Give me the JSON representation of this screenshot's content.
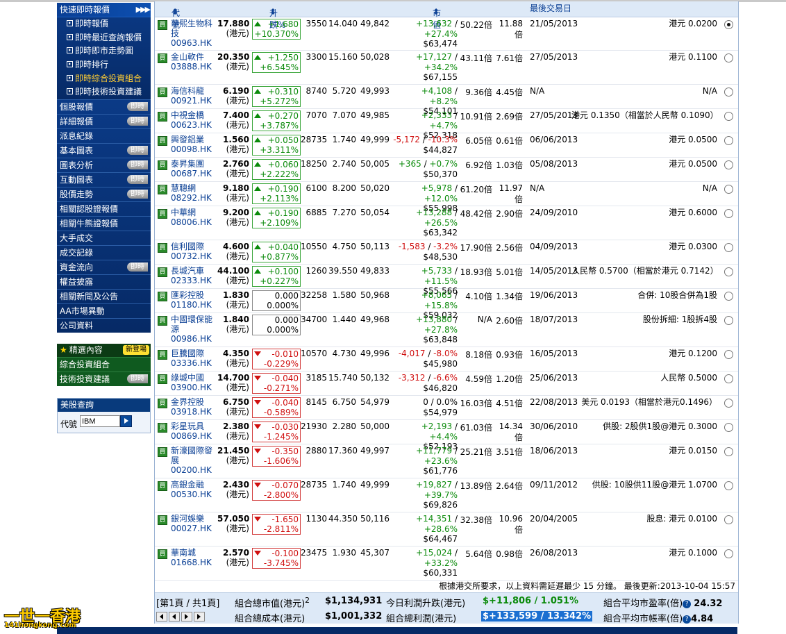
{
  "sidebar": {
    "quick_menu_title": "快速即時報價",
    "quick_items": [
      "即時報價",
      "即時最近查詢報價",
      "即時即市走勢圖",
      "即時排行",
      "即時綜合投資組合",
      "即時技術投資建議"
    ],
    "active_quick_index": 4,
    "nav_items": [
      {
        "label": "個股報價",
        "badge": "即時"
      },
      {
        "label": "詳細報價",
        "badge": "即時"
      },
      {
        "label": "派息紀錄",
        "badge": ""
      },
      {
        "label": "基本圖表",
        "badge": "即時"
      },
      {
        "label": "圖表分析",
        "badge": "即時"
      },
      {
        "label": "互動圖表",
        "badge": "即時"
      },
      {
        "label": "股價走勢",
        "badge": "即時"
      },
      {
        "label": "相關認股證報價",
        "badge": ""
      },
      {
        "label": "相關牛熊證報價",
        "badge": ""
      },
      {
        "label": "大手成交",
        "badge": ""
      },
      {
        "label": "成交記錄",
        "badge": ""
      },
      {
        "label": "資金流向",
        "badge": "即時"
      },
      {
        "label": "權益披露",
        "badge": ""
      },
      {
        "label": "相關新聞及公告",
        "badge": ""
      },
      {
        "label": "AA市場異動",
        "badge": ""
      },
      {
        "label": "公司資料",
        "badge": ""
      }
    ],
    "featured": {
      "title": "精選內容",
      "new_badge": "新登場",
      "items": [
        {
          "label": "綜合投資組合",
          "badge": ""
        },
        {
          "label": "技術投資建議",
          "badge": "即時"
        }
      ]
    },
    "us_quote": {
      "title": "美股查詢",
      "code_label": "代號",
      "code_value": "IBM"
    }
  },
  "table": {
    "headers": {
      "code": "代號",
      "change": "升跌%",
      "market_value": "市值",
      "last_trade_date": "最後交易日"
    },
    "buy_label": "買",
    "unit": "(港元)",
    "rows": [
      {
        "name": "華熙生物科技",
        "code": "00963.HK",
        "price": "17.880",
        "chg": "+1.680",
        "pct": "+10.370%",
        "dir": "up",
        "qty": "3550",
        "cost": "14.040",
        "avg": "49,842",
        "pl": "+13,632",
        "plpct": "+27.4%",
        "mv": "$63,474",
        "pldir": "up",
        "pe": "50.22倍",
        "pb": "11.88倍",
        "date": "21/05/2013",
        "div": "港元  0.0200",
        "selected": true,
        "h": 48
      },
      {
        "name": "金山軟件",
        "code": "03888.HK",
        "price": "20.350",
        "chg": "+1.250",
        "pct": "+6.545%",
        "dir": "up",
        "qty": "3300",
        "cost": "15.160",
        "avg": "50,028",
        "pl": "+17,127",
        "plpct": "+34.2%",
        "mv": "$67,155",
        "pldir": "up",
        "pe": "43.11倍",
        "pb": "7.61倍",
        "date": "27/05/2013",
        "div": "港元  0.1100",
        "selected": false,
        "h": 49
      },
      {
        "name": "海信科龍",
        "code": "00921.HK",
        "price": "6.190",
        "chg": "+0.310",
        "pct": "+5.272%",
        "dir": "up",
        "qty": "8740",
        "cost": "5.720",
        "avg": "49,993",
        "pl": "+4,108",
        "plpct": "+8.2%",
        "mv": "$54,101",
        "pldir": "up",
        "pe": "9.36倍",
        "pb": "4.45倍",
        "date": "N/A",
        "div": "N/A",
        "selected": false,
        "h": 35
      },
      {
        "name": "中視金橋",
        "code": "00623.HK",
        "price": "7.400",
        "chg": "+0.270",
        "pct": "+3.787%",
        "dir": "up",
        "qty": "7070",
        "cost": "7.070",
        "avg": "49,985",
        "pl": "+2,333",
        "plpct": "+4.7%",
        "mv": "$52,318",
        "pldir": "up",
        "pe": "10.91倍",
        "pb": "2.69倍",
        "date": "27/05/2013",
        "div": "港元  0.1350（相當於人民幣 0.1090）",
        "selected": false,
        "h": 35
      },
      {
        "name": "興發鋁業",
        "code": "00098.HK",
        "price": "1.560",
        "chg": "+0.050",
        "pct": "+3.311%",
        "dir": "up",
        "qty": "28735",
        "cost": "1.740",
        "avg": "49,999",
        "pl": "-5,172",
        "plpct": "-10.3%",
        "mv": "$44,827",
        "pldir": "dn",
        "pe": "6.05倍",
        "pb": "0.61倍",
        "date": "06/06/2013",
        "div": "港元  0.0500",
        "selected": false,
        "h": 35
      },
      {
        "name": "泰昇集團",
        "code": "00687.HK",
        "price": "2.760",
        "chg": "+0.060",
        "pct": "+2.222%",
        "dir": "up",
        "qty": "18250",
        "cost": "2.740",
        "avg": "50,005",
        "pl": "+365",
        "plpct": "+0.7%",
        "mv": "$50,370",
        "pldir": "up",
        "pe": "6.92倍",
        "pb": "1.03倍",
        "date": "05/08/2013",
        "div": "港元  0.0500",
        "selected": false,
        "h": 35
      },
      {
        "name": "慧聰網",
        "code": "08292.HK",
        "price": "9.180",
        "chg": "+0.190",
        "pct": "+2.113%",
        "dir": "up",
        "qty": "6100",
        "cost": "8.200",
        "avg": "50,020",
        "pl": "+5,978",
        "plpct": "+12.0%",
        "mv": "$55,998",
        "pldir": "up",
        "pe": "61.20倍",
        "pb": "11.97倍",
        "date": "N/A",
        "div": "N/A",
        "selected": false,
        "h": 35
      },
      {
        "name": "中華網",
        "code": "08006.HK",
        "price": "9.200",
        "chg": "+0.190",
        "pct": "+2.109%",
        "dir": "up",
        "qty": "6885",
        "cost": "7.270",
        "avg": "50,054",
        "pl": "+13,288",
        "plpct": "+26.5%",
        "mv": "$63,342",
        "pldir": "up",
        "pe": "48.42倍",
        "pb": "2.90倍",
        "date": "24/09/2010",
        "div": "港元  0.6000",
        "selected": false,
        "h": 49
      },
      {
        "name": "信利國際",
        "code": "00732.HK",
        "price": "4.600",
        "chg": "+0.040",
        "pct": "+0.877%",
        "dir": "up",
        "qty": "10550",
        "cost": "4.750",
        "avg": "50,113",
        "pl": "-1,583",
        "plpct": "-3.2%",
        "mv": "$48,530",
        "pldir": "dn",
        "pe": "17.90倍",
        "pb": "2.56倍",
        "date": "04/09/2013",
        "div": "港元  0.0300",
        "selected": false,
        "h": 35
      },
      {
        "name": "長城汽車",
        "code": "02333.HK",
        "price": "44.100",
        "chg": "+0.100",
        "pct": "+0.227%",
        "dir": "up",
        "qty": "1260",
        "cost": "39.550",
        "avg": "49,833",
        "pl": "+5,733",
        "plpct": "+11.5%",
        "mv": "$55,566",
        "pldir": "up",
        "pe": "18.93倍",
        "pb": "5.01倍",
        "date": "14/05/2013",
        "div": "人民幣  0.5700（相當於港元 0.7142）",
        "selected": false,
        "h": 35
      },
      {
        "name": "匯彩控股",
        "code": "01180.HK",
        "price": "1.830",
        "chg": "0.000",
        "pct": "0.000%",
        "dir": "flat",
        "qty": "32258",
        "cost": "1.580",
        "avg": "50,968",
        "pl": "+8,065",
        "plpct": "+15.8%",
        "mv": "$59,032",
        "pldir": "up",
        "pe": "4.10倍",
        "pb": "1.34倍",
        "date": "19/06/2013",
        "div": "合併: 10股合併為1股",
        "selected": false,
        "h": 35
      },
      {
        "name": "中國環保能源",
        "code": "00986.HK",
        "price": "1.840",
        "chg": "0.000",
        "pct": "0.000%",
        "dir": "flat",
        "qty": "34700",
        "cost": "1.440",
        "avg": "49,968",
        "pl": "+13,880",
        "plpct": "+27.8%",
        "mv": "$63,848",
        "pldir": "up",
        "pe": "N/A",
        "pb": "2.60倍",
        "date": "18/07/2013",
        "div": "股份拆細: 1股拆4股",
        "selected": false,
        "h": 49
      },
      {
        "name": "巨騰國際",
        "code": "03336.HK",
        "price": "4.350",
        "chg": "-0.010",
        "pct": "-0.229%",
        "dir": "down",
        "qty": "10570",
        "cost": "4.730",
        "avg": "49,996",
        "pl": "-4,017",
        "plpct": "-8.0%",
        "mv": "$45,980",
        "pldir": "dn",
        "pe": "8.18倍",
        "pb": "0.93倍",
        "date": "16/05/2013",
        "div": "港元  0.1200",
        "selected": false,
        "h": 35
      },
      {
        "name": "綠城中國",
        "code": "03900.HK",
        "price": "14.700",
        "chg": "-0.040",
        "pct": "-0.271%",
        "dir": "down",
        "qty": "3185",
        "cost": "15.740",
        "avg": "50,132",
        "pl": "-3,312",
        "plpct": "-6.6%",
        "mv": "$46,820",
        "pldir": "dn",
        "pe": "4.59倍",
        "pb": "1.20倍",
        "date": "25/06/2013",
        "div": "人民幣  0.5000",
        "selected": false,
        "h": 35
      },
      {
        "name": "金界控股",
        "code": "03918.HK",
        "price": "6.750",
        "chg": "-0.040",
        "pct": "-0.589%",
        "dir": "down",
        "qty": "8145",
        "cost": "6.750",
        "avg": "54,979",
        "pl": "0",
        "plpct": "0.0%",
        "mv": "$54,979",
        "pldir": "flat",
        "pe": "16.03倍",
        "pb": "4.51倍",
        "date": "22/08/2013",
        "div": "美元  0.0193（相當於港元0.1496）",
        "selected": false,
        "h": 35
      },
      {
        "name": "彩星玩具",
        "code": "00869.HK",
        "price": "2.380",
        "chg": "-0.030",
        "pct": "-1.245%",
        "dir": "down",
        "qty": "21930",
        "cost": "2.280",
        "avg": "50,000",
        "pl": "+2,193",
        "plpct": "+4.4%",
        "mv": "$52,193",
        "pldir": "up",
        "pe": "61.03倍",
        "pb": "14.34倍",
        "date": "30/06/2010",
        "div": "供股: 2股供1股@港元  0.3000",
        "selected": false,
        "h": 35
      },
      {
        "name": "新濠國際發展",
        "code": "00200.HK",
        "price": "21.450",
        "chg": "-0.350",
        "pct": "-1.606%",
        "dir": "down",
        "qty": "2880",
        "cost": "17.360",
        "avg": "49,997",
        "pl": "+11,779",
        "plpct": "+23.6%",
        "mv": "$61,776",
        "pldir": "up",
        "pe": "25.21倍",
        "pb": "3.51倍",
        "date": "18/06/2013",
        "div": "港元  0.0150",
        "selected": false,
        "h": 49
      },
      {
        "name": "高銀金融",
        "code": "00530.HK",
        "price": "2.430",
        "chg": "-0.070",
        "pct": "-2.800%",
        "dir": "down",
        "qty": "28735",
        "cost": "1.740",
        "avg": "49,999",
        "pl": "+19,827",
        "plpct": "+39.7%",
        "mv": "$69,826",
        "pldir": "up",
        "pe": "13.89倍",
        "pb": "2.64倍",
        "date": "09/11/2012",
        "div": "供股: 10股供11股@港元  1.0700",
        "selected": false,
        "h": 49
      },
      {
        "name": "銀河娛樂",
        "code": "00027.HK",
        "price": "57.050",
        "chg": "-1.650",
        "pct": "-2.811%",
        "dir": "down",
        "qty": "1130",
        "cost": "44.350",
        "avg": "50,116",
        "pl": "+14,351",
        "plpct": "+28.6%",
        "mv": "$64,467",
        "pldir": "up",
        "pe": "32.38倍",
        "pb": "10.96倍",
        "date": "20/04/2005",
        "div": "股息: 港元  0.0100",
        "selected": false,
        "h": 49
      },
      {
        "name": "華南城",
        "code": "01668.HK",
        "price": "2.570",
        "chg": "-0.100",
        "pct": "-3.745%",
        "dir": "down",
        "qty": "23475",
        "cost": "1.930",
        "avg": "45,307",
        "pl": "+15,024",
        "plpct": "+33.2%",
        "mv": "$60,331",
        "pldir": "up",
        "pe": "5.64倍",
        "pb": "0.98倍",
        "date": "26/08/2013",
        "div": "港元  0.1000",
        "selected": false,
        "h": 49
      }
    ],
    "note": "根據港交所要求，以上資料需延遲最少  15 分鐘。 最後更新:2013-10-04 15:57"
  },
  "summary": {
    "page_info": "[第1頁 / 共1頁]",
    "total_value_label": "組合總市值(港元)",
    "total_value_sup": "2",
    "total_value": "$1,134,931",
    "total_cost_label": "組合總成本(港元)",
    "total_cost": "$1,001,332",
    "today_pl_label": "今日利潤升跌(港元)",
    "today_pl": "$+11,806 / 1.051%",
    "total_pl_label": "組合總利潤(港元)",
    "total_pl": "$+133,599 / 13.342%",
    "avg_pe_label": "組合平均市盈率(倍)",
    "avg_pe": "24.32",
    "avg_pb_label": "組合平均市帳率(倍)",
    "avg_pb": "4.84"
  },
  "watermark": {
    "line1": "一世一香港",
    "line2": "141hongkong.com"
  },
  "colors": {
    "up": "#0a8a0a",
    "down": "#d01010",
    "nav_bg": "#062a66",
    "header_bg": "#dde9f7"
  }
}
